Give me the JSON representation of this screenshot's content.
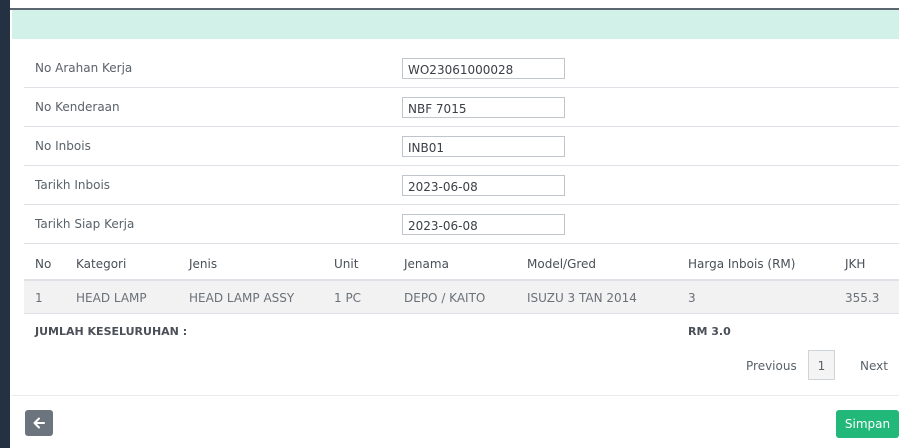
{
  "form": {
    "fields": [
      {
        "label": "No Arahan Kerja",
        "value": "WO23061000028"
      },
      {
        "label": "No Kenderaan",
        "value": "NBF 7015"
      },
      {
        "label": "No Inbois",
        "value": "INB01"
      },
      {
        "label": "Tarikh Inbois",
        "value": "2023-06-08"
      },
      {
        "label": "Tarikh Siap Kerja",
        "value": "2023-06-08"
      }
    ]
  },
  "table": {
    "headers": [
      "No",
      "Kategori",
      "Jenis",
      "Unit",
      "Jenama",
      "Model/Gred",
      "Harga Inbois (RM)",
      "JKH"
    ],
    "rows": [
      [
        "1",
        "HEAD LAMP",
        "HEAD LAMP ASSY",
        "1 PC",
        "DEPO / KAITO",
        "ISUZU 3 TAN 2014",
        "3",
        "355.3"
      ]
    ]
  },
  "summary": {
    "label": "JUMLAH KESELURUHAN :",
    "value": "RM 3.0"
  },
  "pagination": {
    "previous": "Previous",
    "page": "1",
    "next": "Next"
  },
  "actions": {
    "back_icon": "arrow-left-icon",
    "save_label": "Simpan"
  },
  "colors": {
    "header_band": "#d2f1e8",
    "save_button": "#21b87a",
    "back_button": "#6c757d",
    "sidebar": "#243142"
  }
}
